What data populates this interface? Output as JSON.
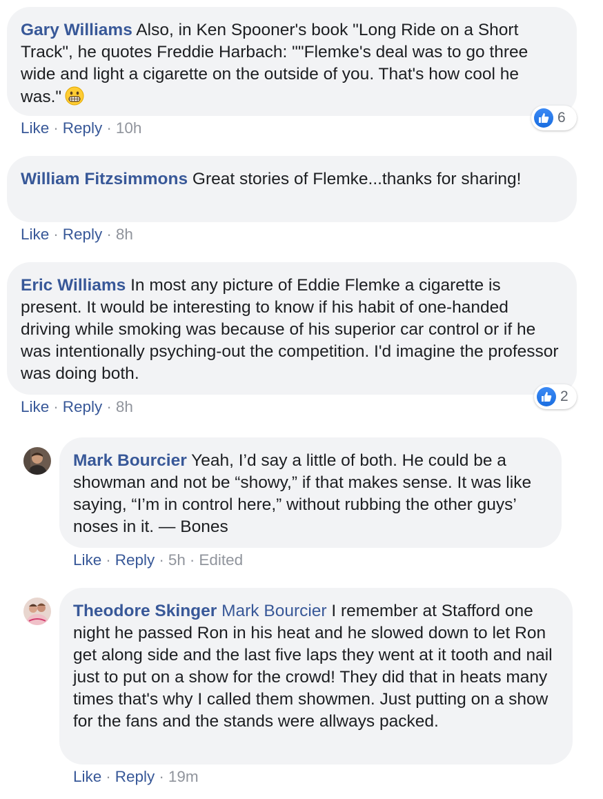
{
  "comments": [
    {
      "author": "Gary Williams",
      "text": "Also, in Ken Spooner's book \"Long Ride on a Short Track\", he quotes Freddie Harbach: \"\"Flemke's deal was to go three wide and light a cigarette on the outside of you. That's how cool he was.\"",
      "emoji_icon": "grimacing-face-emoji-icon",
      "like_label": "Like",
      "reply_label": "Reply",
      "time": "10h",
      "reactions": "6"
    },
    {
      "author": "William Fitzsimmons",
      "text": "Great stories of Flemke...thanks for sharing!",
      "like_label": "Like",
      "reply_label": "Reply",
      "time": "8h"
    },
    {
      "author": "Eric Williams",
      "text": "In most any picture of Eddie Flemke a cigarette is present. It would be interesting to know if his habit of one-handed driving while smoking was because of his superior car control or if he was intentionally psyching-out the competition. I'd imagine the professor was doing both.",
      "like_label": "Like",
      "reply_label": "Reply",
      "time": "8h",
      "reactions": "2"
    }
  ],
  "replies": [
    {
      "author": "Mark Bourcier",
      "text": "Yeah, I’d say a little of both. He could be a showman and not be “showy,” if that makes sense. It was like saying, “I’m in control here,” without rubbing the other guys’ noses in it. — Bones",
      "like_label": "Like",
      "reply_label": "Reply",
      "time": "5h",
      "edited": "Edited",
      "avatar_icon": "user-avatar-photo"
    },
    {
      "author": "Theodore Skinger",
      "mention": "Mark Bourcier",
      "text": "I remember at Stafford one night he passed Ron in his heat and he slowed down to let Ron get along side and the last five laps they went at it tooth and nail just to put on a show for the crowd! They did that in heats many times that's why I called them showmen. Just putting on a show for the fans and the stands were allways packed.",
      "like_label": "Like",
      "reply_label": "Reply",
      "time": "19m",
      "avatar_icon": "user-avatar-photo"
    }
  ],
  "colors": {
    "author": "#385898",
    "bubble": "#f2f3f5",
    "meta": "#90949c",
    "like_badge": "#1877f2"
  }
}
